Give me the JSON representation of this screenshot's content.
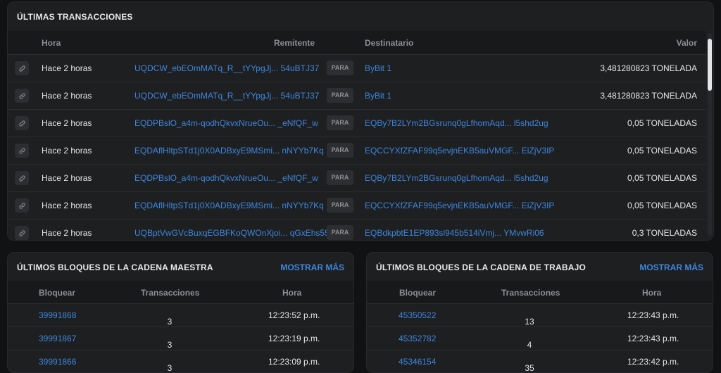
{
  "transactions": {
    "title": "ÚLTIMAS TRANSACCIONES",
    "headers": {
      "time": "Hora",
      "sender": "Remitente",
      "recipient": "Destinatario",
      "value": "Valor"
    },
    "rows": [
      {
        "time": "Hace 2 horas",
        "from": "UQDCW_ebEOmMATq_R__tYYpgJj... 54uBTJ37",
        "para": "PARA",
        "to": "ByBit 1",
        "value": "3,481280823 TONELADA"
      },
      {
        "time": "Hace 2 horas",
        "from": "UQDCW_ebEOmMATq_R__tYYpgJj... 54uBTJ37",
        "para": "PARA",
        "to": "ByBit 1",
        "value": "3,481280823 TONELADA"
      },
      {
        "time": "Hace 2 horas",
        "from": "EQDPBslO_a4m-qodhQkvxNrueOu... _eNfQF_w",
        "para": "PARA",
        "to": "EQBy7B2LYm2BGsrunq0gLfhomAqd... l5shd2ug",
        "value": "0,05 TONELADAS"
      },
      {
        "time": "Hace 2 horas",
        "from": "EQDAflHltpSTd1j0X0ADBxyE9MSmi... nNYYb7Kq",
        "para": "PARA",
        "to": "EQCCYXfZFAF99q5evjnEKB5auVMGF... EiZjV3IP",
        "value": "0,05 TONELADAS"
      },
      {
        "time": "Hace 2 horas",
        "from": "EQDPBslO_a4m-qodhQkvxNrueOu... _eNfQF_w",
        "para": "PARA",
        "to": "EQBy7B2LYm2BGsrunq0gLfhomAqd... l5shd2ug",
        "value": "0,05 TONELADAS"
      },
      {
        "time": "Hace 2 horas",
        "from": "EQDAflHltpSTd1j0X0ADBxyE9MSmi... nNYYb7Kq",
        "para": "PARA",
        "to": "EQCCYXfZFAF99q5evjnEKB5auVMGF... EiZjV3IP",
        "value": "0,05 TONELADAS"
      },
      {
        "time": "Hace 2 horas",
        "from": "UQBptVwGVcBuxqEGBFKoQWOnXjoi... qGxEhs55",
        "para": "PARA",
        "to": "EQBdkpbtE1EP893sl945b514iVmj... YMvwRi06",
        "value": "0,3 TONELADAS"
      }
    ]
  },
  "master_blocks": {
    "title": "ÚLTIMOS BLOQUES DE LA CADENA MAESTRA",
    "more": "MOSTRAR MÁS",
    "headers": {
      "block": "Bloquear",
      "tx": "Transacciones",
      "time": "Hora"
    },
    "rows": [
      {
        "block": "39991868",
        "tx": "3",
        "time": "12:23:52 p.m."
      },
      {
        "block": "39991867",
        "tx": "3",
        "time": "12:23:19 p.m."
      },
      {
        "block": "39991866",
        "tx": "3",
        "time": "12:23:09 p.m."
      }
    ]
  },
  "work_blocks": {
    "title": "ÚLTIMOS BLOQUES DE LA CADENA DE TRABAJO",
    "more": "MOSTRAR MÁS",
    "headers": {
      "block": "Bloquear",
      "tx": "Transacciones",
      "time": "Hora"
    },
    "rows": [
      {
        "block": "45350522",
        "tx": "13",
        "time": "12:23:43 p.m."
      },
      {
        "block": "45352782",
        "tx": "4",
        "time": "12:23:43 p.m."
      },
      {
        "block": "45346154",
        "tx": "35",
        "time": "12:23:42 p.m."
      }
    ]
  },
  "icons": {
    "row_link": "link-icon"
  },
  "colors": {
    "background": "#111213",
    "card": "#1e1f21",
    "link": "#3d86dd"
  }
}
